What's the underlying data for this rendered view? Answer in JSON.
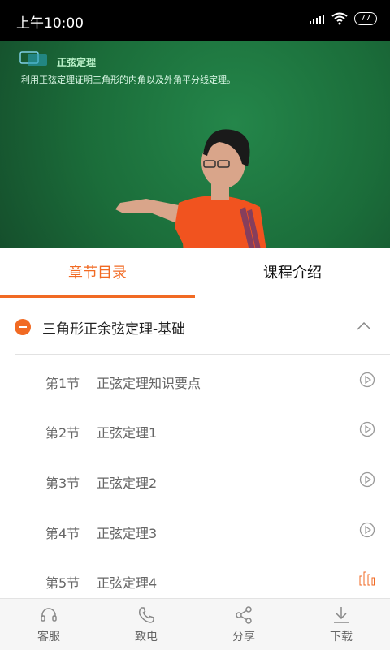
{
  "status": {
    "time": "上午10:00",
    "battery": "77"
  },
  "video": {
    "slide_title": "正弦定理",
    "slide_subtitle": "利用正弦定理证明三角形的内角以及外角平分线定理。"
  },
  "tabs": [
    {
      "label": "章节目录",
      "active": true
    },
    {
      "label": "课程介绍",
      "active": false
    }
  ],
  "chapter": {
    "title": "三角形正余弦定理-基础"
  },
  "sections": [
    {
      "num": "第1节",
      "title": "正弦定理知识要点",
      "state": "play"
    },
    {
      "num": "第2节",
      "title": "正弦定理1",
      "state": "play"
    },
    {
      "num": "第3节",
      "title": "正弦定理2",
      "state": "play"
    },
    {
      "num": "第4节",
      "title": "正弦定理3",
      "state": "play"
    },
    {
      "num": "第5节",
      "title": "正弦定理4",
      "state": "playing"
    }
  ],
  "bottom_bar": [
    {
      "label": "客服",
      "icon": "headset-icon"
    },
    {
      "label": "致电",
      "icon": "phone-icon"
    },
    {
      "label": "分享",
      "icon": "share-icon"
    },
    {
      "label": "下载",
      "icon": "download-icon"
    }
  ],
  "colors": {
    "accent": "#f16a23",
    "board": "#1b6d3a"
  }
}
